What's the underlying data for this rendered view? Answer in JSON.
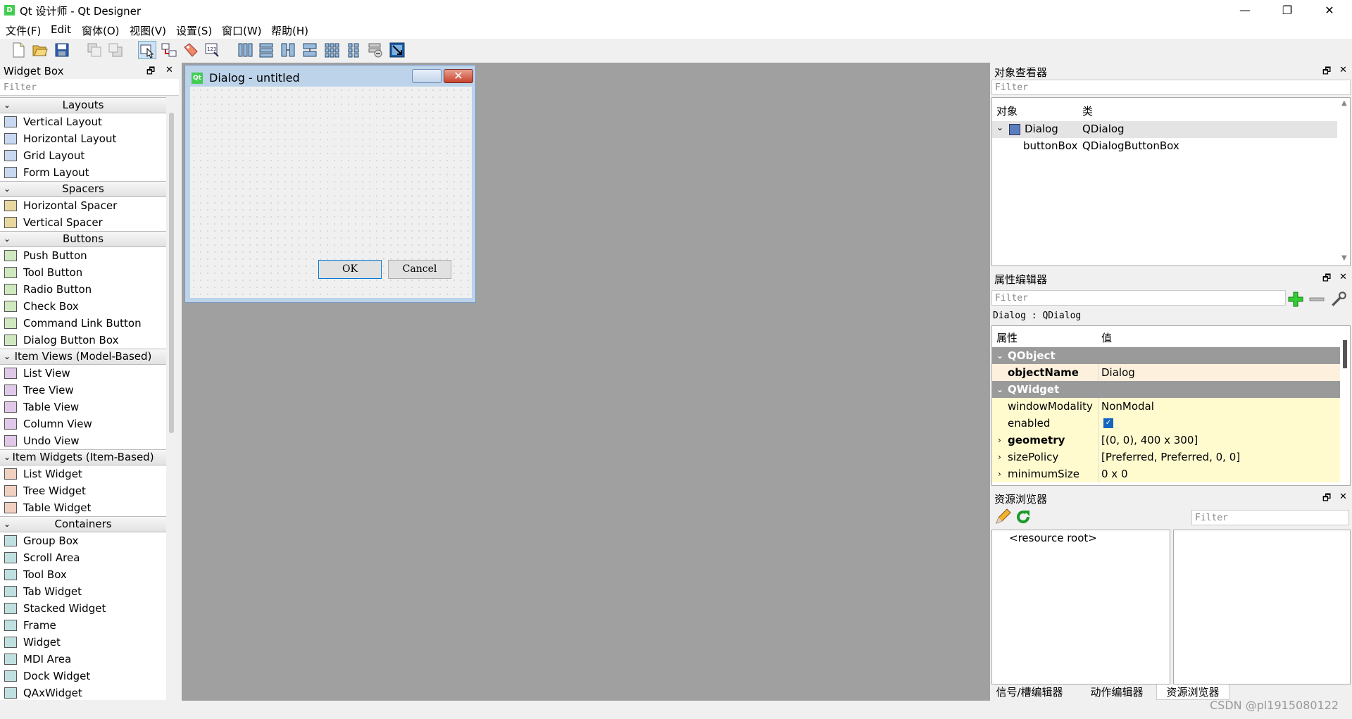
{
  "window": {
    "title": "Qt 设计师 - Qt Designer",
    "app_icon": "D",
    "minimize": "—",
    "maximize": "❐",
    "close": "✕"
  },
  "menu": [
    "文件(F)",
    "Edit",
    "窗体(O)",
    "视图(V)",
    "设置(S)",
    "窗口(W)",
    "帮助(H)"
  ],
  "toolbar_icons": [
    "new-icon",
    "open-icon",
    "save-icon",
    "send-to-back-icon",
    "bring-to-front-icon",
    "edit-widgets-icon",
    "edit-signals-slots-icon",
    "edit-buddies-icon",
    "edit-tab-order-icon",
    "layout-horizontal-icon",
    "layout-vertical-icon",
    "layout-horizontal-splitter-icon",
    "layout-vertical-splitter-icon",
    "layout-grid-icon",
    "layout-form-icon",
    "break-layout-icon",
    "adjust-size-icon"
  ],
  "widget_box": {
    "title": "Widget Box",
    "float": "🗗",
    "close": "✕",
    "filter_placeholder": "Filter",
    "categories": [
      {
        "name": "Layouts",
        "items": [
          "Vertical Layout",
          "Horizontal Layout",
          "Grid Layout",
          "Form Layout"
        ]
      },
      {
        "name": "Spacers",
        "items": [
          "Horizontal Spacer",
          "Vertical Spacer"
        ]
      },
      {
        "name": "Buttons",
        "items": [
          "Push Button",
          "Tool Button",
          "Radio Button",
          "Check Box",
          "Command Link Button",
          "Dialog Button Box"
        ]
      },
      {
        "name": "Item Views (Model-Based)",
        "items": [
          "List View",
          "Tree View",
          "Table View",
          "Column View",
          "Undo View"
        ]
      },
      {
        "name": "Item Widgets (Item-Based)",
        "items": [
          "List Widget",
          "Tree Widget",
          "Table Widget"
        ]
      },
      {
        "name": "Containers",
        "items": [
          "Group Box",
          "Scroll Area",
          "Tool Box",
          "Tab Widget",
          "Stacked Widget",
          "Frame",
          "Widget",
          "MDI Area",
          "Dock Widget",
          "QAxWidget"
        ]
      }
    ]
  },
  "dialog": {
    "title": "Dialog - untitled",
    "qt_badge": "Qt",
    "ok": "OK",
    "cancel": "Cancel",
    "close": "✕"
  },
  "object_inspector": {
    "title": "对象查看器",
    "filter_placeholder": "Filter",
    "col_object": "对象",
    "col_class": "类",
    "rows": [
      {
        "object": "Dialog",
        "class": "QDialog"
      },
      {
        "object": "buttonBox",
        "class": "QDialogButtonBox"
      }
    ]
  },
  "property_editor": {
    "title": "属性编辑器",
    "filter_placeholder": "Filter",
    "context": "Dialog : QDialog",
    "col_property": "属性",
    "col_value": "值",
    "groups": [
      {
        "name": "QObject",
        "props": [
          {
            "name": "objectName",
            "value": "Dialog",
            "bold": true
          }
        ]
      },
      {
        "name": "QWidget",
        "props": [
          {
            "name": "windowModality",
            "value": "NonModal",
            "bold": false
          },
          {
            "name": "enabled",
            "value": "",
            "bold": false,
            "checkbox": true
          },
          {
            "name": "geometry",
            "value": "[(0, 0), 400 x 300]",
            "bold": true,
            "expand": true
          },
          {
            "name": "sizePolicy",
            "value": "[Preferred, Preferred, 0, 0]",
            "bold": false,
            "expand": true
          },
          {
            "name": "minimumSize",
            "value": "0 x 0",
            "bold": false,
            "expand": true
          }
        ]
      }
    ]
  },
  "resource_browser": {
    "title": "资源浏览器",
    "filter_placeholder": "Filter",
    "root": "<resource root>"
  },
  "bottom_tabs": [
    "信号/槽编辑器",
    "动作编辑器",
    "资源浏览器"
  ],
  "watermark": "CSDN @pl1915080122"
}
